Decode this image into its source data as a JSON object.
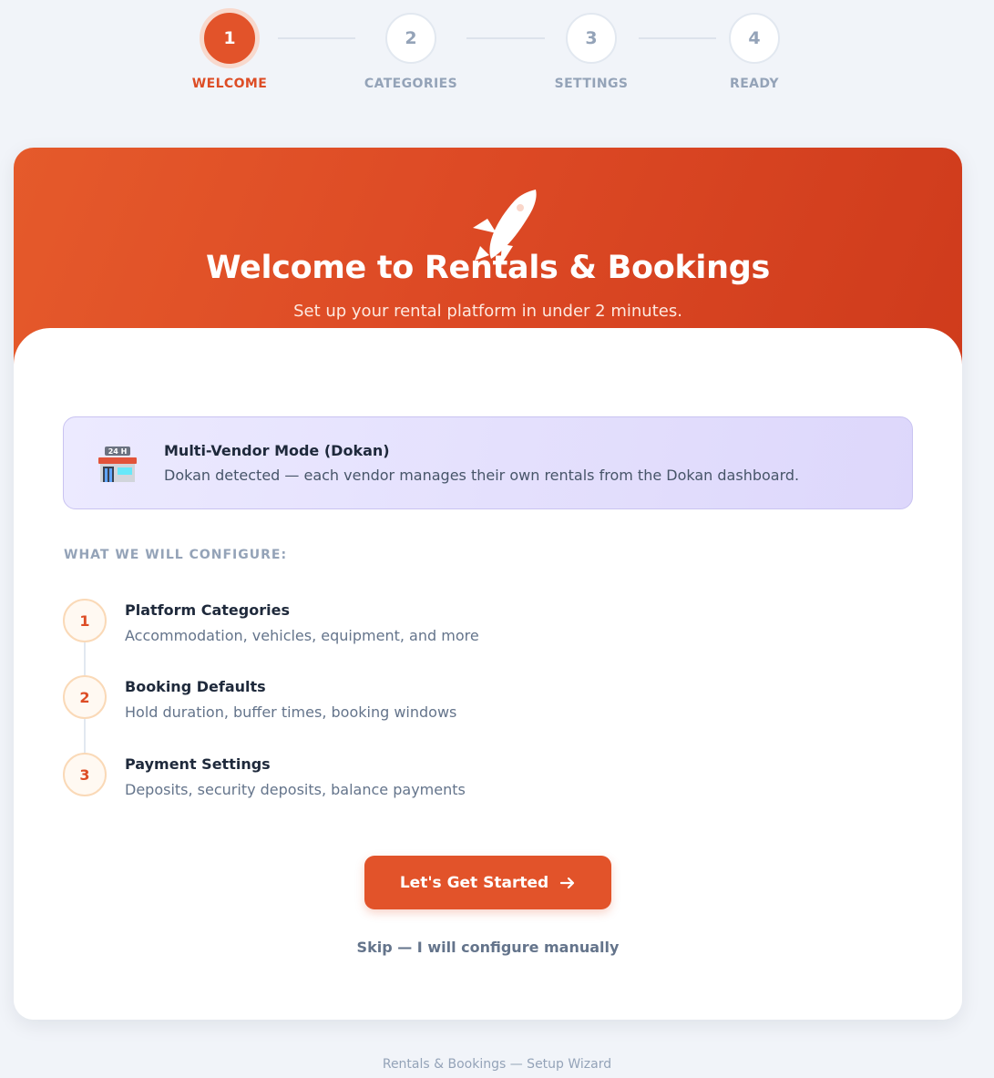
{
  "stepper": {
    "steps": [
      {
        "number": "1",
        "label": "WELCOME",
        "active": true
      },
      {
        "number": "2",
        "label": "CATEGORIES",
        "active": false
      },
      {
        "number": "3",
        "label": "SETTINGS",
        "active": false
      },
      {
        "number": "4",
        "label": "READY",
        "active": false
      }
    ]
  },
  "hero": {
    "icon": "rocket-icon",
    "title": "Welcome to Rentals & Bookings",
    "subtitle": "Set up your rental platform in under 2 minutes."
  },
  "notice": {
    "icon": "store-24h-icon",
    "icon_text": "24 H",
    "title": "Multi-Vendor Mode (Dokan)",
    "text": "Dokan detected — each vendor manages their own rentals from the Dokan dashboard."
  },
  "configure": {
    "heading": "WHAT WE WILL CONFIGURE:",
    "items": [
      {
        "number": "1",
        "title": "Platform Categories",
        "description": "Accommodation, vehicles, equipment, and more"
      },
      {
        "number": "2",
        "title": "Booking Defaults",
        "description": "Hold duration, buffer times, booking windows"
      },
      {
        "number": "3",
        "title": "Payment Settings",
        "description": "Deposits, security deposits, balance payments"
      }
    ]
  },
  "actions": {
    "start_label": "Let's Get Started",
    "skip_label": "Skip — I will configure manually"
  },
  "footer": {
    "text": "Rentals & Bookings — Setup Wizard"
  },
  "colors": {
    "accent": "#e2532a",
    "notice_bg": "#e4e0fd",
    "muted": "#94a3b8"
  }
}
